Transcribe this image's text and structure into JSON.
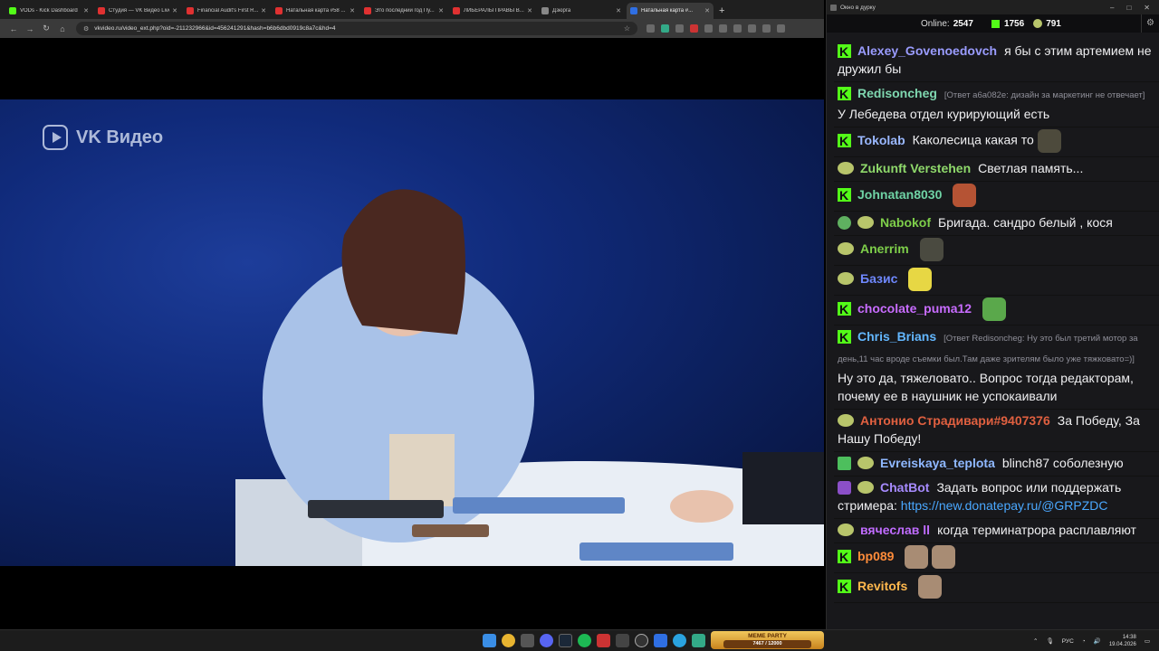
{
  "browser": {
    "tabs": [
      {
        "label": "VODs - Kick Dashboard",
        "color": "#53fc18",
        "active": false
      },
      {
        "label": "Студия — VK Видео Live",
        "color": "#e03131",
        "active": false
      },
      {
        "label": "Financial Audit's First R...",
        "color": "#e03131",
        "active": false
      },
      {
        "label": "Натальная карта #58 ...",
        "color": "#e03131",
        "active": false
      },
      {
        "label": "Это последний год Пу...",
        "color": "#e03131",
        "active": false
      },
      {
        "label": "ЛИБЕРАЛЫ ПРАВЫ В...",
        "color": "#e03131",
        "active": false
      },
      {
        "label": "Дзюрга",
        "color": "#888888",
        "active": false
      },
      {
        "label": "Натальная карта #...",
        "color": "#2f6fe3",
        "active": true
      }
    ],
    "url": "vkvideo.ru/video_ext.php?oid=-211232966&id=456241291&hash=b6b6dbd0919c8a7c&hd=4",
    "video_watermark": "VK Видео"
  },
  "chat_window": {
    "title": "Окно в дурку",
    "online_label": "Online:",
    "online_count": "2547",
    "kick_count": "1756",
    "peepo_count": "791"
  },
  "messages": [
    {
      "badges": [
        "k"
      ],
      "user": "Alexey_Govenoedovch",
      "color": "#9a9cff",
      "reply": "",
      "text": "я бы с этим артемием не дружил бы",
      "emotes": []
    },
    {
      "badges": [
        "k"
      ],
      "user": "Redisoncheg",
      "color": "#7fd7b0",
      "reply": "[Ответ a6a082e: дизайн за маркетинг не отвечает]",
      "text": "У Лебедева отдел курирующий есть",
      "emotes": []
    },
    {
      "badges": [
        "k"
      ],
      "user": "Tokolab",
      "color": "#9ab8ff",
      "reply": "",
      "text": "Каколесица какая то",
      "emotes": [
        "#4d4a3c"
      ]
    },
    {
      "badges": [
        "peepo"
      ],
      "user": "Zukunft Verstehen",
      "color": "#8fd96b",
      "reply": "",
      "text": "Светлая память...",
      "emotes": []
    },
    {
      "badges": [
        "k"
      ],
      "user": "Johnatan8030",
      "color": "#6fd3a5",
      "reply": "",
      "text": "",
      "emotes": [
        "#b55334"
      ]
    },
    {
      "badges": [
        "veri",
        "peepo"
      ],
      "user": "Nabokof",
      "color": "#7ecf4a",
      "reply": "",
      "text": "Бригада. сандро белый , кося",
      "emotes": []
    },
    {
      "badges": [
        "peepo"
      ],
      "user": "Anerrim",
      "color": "#7ecf4a",
      "reply": "",
      "text": "",
      "emotes": [
        "#4a4a40"
      ]
    },
    {
      "badges": [
        "peepo"
      ],
      "user": "Базис",
      "color": "#6f88ff",
      "reply": "",
      "text": "",
      "emotes": [
        "#e7d744"
      ]
    },
    {
      "badges": [
        "k"
      ],
      "user": "chocolate_puma12",
      "color": "#c86cff",
      "reply": "",
      "text": "",
      "emotes": [
        "#5aa84b"
      ]
    },
    {
      "badges": [
        "k"
      ],
      "user": "Chris_Brians",
      "color": "#63b7ff",
      "reply": "[Ответ Redisoncheg: Ну это был третий мотор за день,11 час вроде съемки был.Там даже зрителям было уже тяжковато=)]",
      "text": "Ну это да, тяжеловато.. Вопрос тогда редакторам, почему ее в наушник не успокаивали",
      "emotes": []
    },
    {
      "badges": [
        "peepo"
      ],
      "user": "Антонио Страдивари#9407376",
      "color": "#e06040",
      "reply": "",
      "text": "За Победу, За Нашу Победу!",
      "emotes": []
    },
    {
      "badges": [
        "sub",
        "peepo"
      ],
      "user": "Evreiskaya_teplota",
      "color": "#8fb8ff",
      "reply": "",
      "text": "blinch87 соболезную",
      "emotes": []
    },
    {
      "badges": [
        "bot",
        "peepo"
      ],
      "user": "ChatBot",
      "color": "#a78bff",
      "reply": "",
      "text": "Задать вопрос или поддержать стримера:",
      "link": "https://new.donatepay.ru/@GRPZDC",
      "emotes": []
    },
    {
      "badges": [
        "peepo"
      ],
      "user": "вячеслав ll",
      "color": "#c06cff",
      "reply": "",
      "text": "когда терминатрора расплавляют",
      "emotes": []
    },
    {
      "badges": [
        "k"
      ],
      "user": "bp089",
      "color": "#ff8c3a",
      "reply": "",
      "text": "",
      "emotes": [
        "#a88c74",
        "#a88c74"
      ]
    },
    {
      "badges": [
        "k"
      ],
      "user": "Revitofs",
      "color": "#ffb84d",
      "reply": "",
      "text": "",
      "emotes": [
        "#a88c74"
      ]
    }
  ],
  "taskbar": {
    "meme_title": "MEME PARTY",
    "meme_counter": "7467 / 12000",
    "lang": "РУС",
    "time": "14:38",
    "date": "19.04.2026"
  }
}
